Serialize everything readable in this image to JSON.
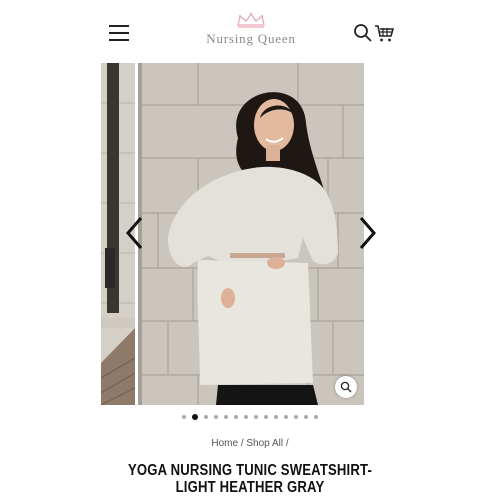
{
  "header": {
    "brand_name": "Nursing Queen",
    "icons": [
      "hamburger-menu-icon",
      "crown-icon",
      "search-icon",
      "cart-icon"
    ],
    "brand_color": "#e6a9b8"
  },
  "gallery": {
    "active_slide": 2,
    "slide_count": 14,
    "prev_icon": "chevron-left-icon",
    "next_icon": "chevron-right-icon",
    "zoom_icon": "zoom-icon"
  },
  "breadcrumb": {
    "home": "Home",
    "separator": "/",
    "shop_all": "Shop All",
    "trailing": "/"
  },
  "product": {
    "title_line1": "YOGA NURSING TUNIC SWEATSHIRT-",
    "title_line2": "LIGHT HEATHER GRAY"
  }
}
